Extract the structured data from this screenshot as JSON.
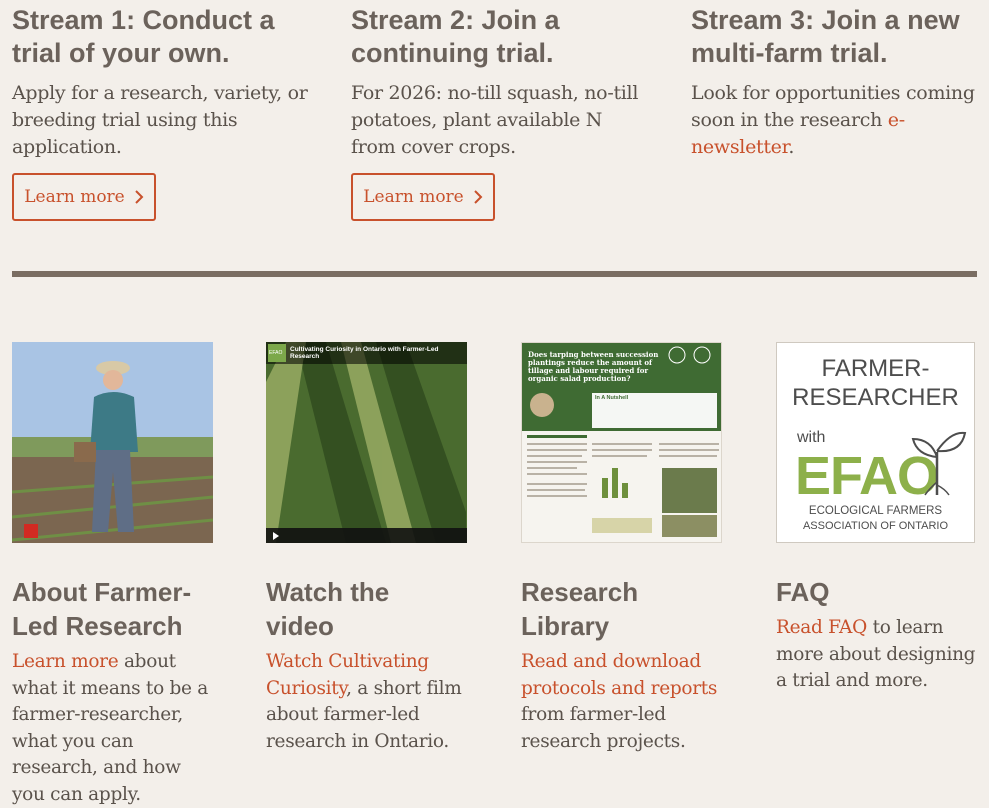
{
  "streams": [
    {
      "title": "Stream 1: Conduct a\ntrial of your own.",
      "text": "Apply for a research, variety, or breeding trial using this application.",
      "button": "Learn more"
    },
    {
      "title": "Stream 2: Join a\ncontinuing trial.",
      "text": "For 2026: no-till squash, no-till potatoes, plant available N from cover crops.",
      "button": "Learn more"
    },
    {
      "title": "Stream 3: Join a new\nmulti-farm trial.",
      "text_before": "Look for opportunities coming soon in the research ",
      "link": "e-newsletter",
      "text_after": "."
    }
  ],
  "cards": [
    {
      "title": "About Farmer-\nLed Research",
      "link": "Learn more",
      "text": " about what it means to be a farmer-researcher, what you can research, and how you can apply."
    },
    {
      "title": "Watch the\nvideo",
      "link": "Watch Cultivating Curiosity",
      "text": ", a short film about farmer-led research in Ontario.",
      "thumb_title": "Cultivating Curiosity in Ontario with Farmer-Led Research",
      "thumb_badge": "EFAO"
    },
    {
      "title": "Research\nLibrary",
      "link": "Read and download protocols and reports",
      "text": " from farmer-led research projects.",
      "thumb_heading": "Does tarping between succession plantings reduce the amount of tillage and labour required for organic salad production?",
      "thumb_box": "In A Nutshell"
    },
    {
      "title": "FAQ",
      "link": "Read FAQ",
      "text": " to learn more about designing a trial and more.",
      "logo": {
        "line1": "FARMER-",
        "line2": "RESEARCHER",
        "with": "with",
        "brand": "EFAO",
        "org1": "ECOLOGICAL FARMERS",
        "org2": "ASSOCIATION OF ONTARIO"
      }
    }
  ],
  "colors": {
    "accent": "#c8512c",
    "heading": "#6b625b",
    "divider": "#7a6d62",
    "efao_green": "#8db04a"
  }
}
